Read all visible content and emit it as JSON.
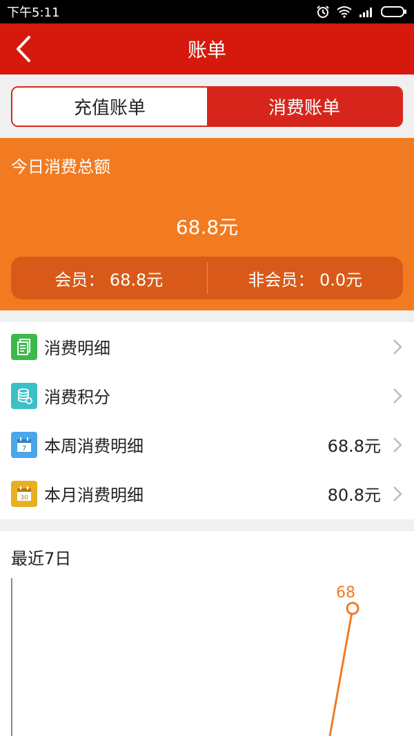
{
  "status_bar": {
    "time": "下午5:11"
  },
  "header": {
    "title": "账单"
  },
  "tabs": {
    "recharge_label": "充值账单",
    "consume_label": "消费账单",
    "selected": "消费账单"
  },
  "summary": {
    "label": "今日消费总额",
    "amount": "68.8元",
    "member": "会员： 68.8元",
    "non_member": "非会员： 0.0元"
  },
  "menu": [
    {
      "label": "消费明细",
      "value": "",
      "icon": "document-icon",
      "color": "#3db84a"
    },
    {
      "label": "消费积分",
      "value": "",
      "icon": "coins-icon",
      "color": "#3cc0c8"
    },
    {
      "label": "本周消费明细",
      "value": "68.8元",
      "icon": "calendar-7-icon",
      "color": "#4aa6e8",
      "icon_text": "7"
    },
    {
      "label": "本月消费明细",
      "value": "80.8元",
      "icon": "calendar-30-icon",
      "color": "#e8b020",
      "icon_text": "30"
    }
  ],
  "chart_section": {
    "title": "最近7日"
  },
  "chart_data": {
    "type": "line",
    "title": "最近7日",
    "series": [
      {
        "values": [
          68
        ],
        "labels": [
          "68"
        ]
      }
    ],
    "color": "#f27b22"
  },
  "colors": {
    "primary": "#d51a0d",
    "summary_bg": "#f27b22",
    "summary_split": "#d95a18"
  }
}
